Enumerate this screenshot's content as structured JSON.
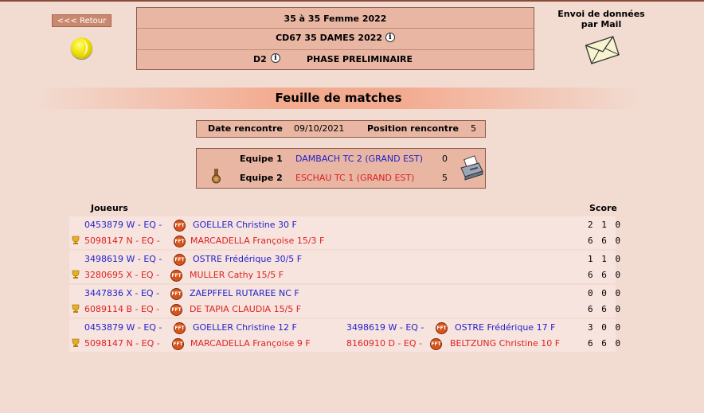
{
  "nav": {
    "back_label": "<<< Retour"
  },
  "header": {
    "title": "35  à 35  Femme  2022",
    "competition": "CD67 35 DAMES 2022",
    "division": "D2",
    "phase": "PHASE PRELIMINAIRE"
  },
  "mail": {
    "line1": "Envoi de données",
    "line2": "par Mail"
  },
  "sheet": {
    "title": "Feuille de matches"
  },
  "meeting": {
    "date_label": "Date rencontre",
    "date_value": "09/10/2021",
    "position_label": "Position rencontre",
    "position_value": "5"
  },
  "teams": [
    {
      "label": "Equipe 1",
      "name": "DAMBACH TC 2 (GRAND EST)",
      "score": "0"
    },
    {
      "label": "Equipe 2",
      "name": "ESCHAU TC 1 (GRAND EST)",
      "score": "5"
    }
  ],
  "table": {
    "players_header": "Joueurs",
    "score_header": "Score"
  },
  "matches": [
    {
      "line1": {
        "id": "0453879 W -   EQ -",
        "player": "GOELLER  Christine  30 F",
        "score": "2 1 0"
      },
      "line2": {
        "id": "5098147 N -   EQ -",
        "player": "MARCADELLA  Françoise 15/3 F",
        "score": "6 6 0"
      }
    },
    {
      "line1": {
        "id": "3498619 W -   EQ -",
        "player": "OSTRE  Frédérique  30/5 F",
        "score": "1 1 0"
      },
      "line2": {
        "id": "3280695 X -   EQ -",
        "player": "MULLER  Cathy 15/5 F",
        "score": "6 6 0"
      }
    },
    {
      "line1": {
        "id": "3447836 X -   EQ -",
        "player": "ZAEPFFEL  RUTAREE  NC F",
        "score": "0 0 0"
      },
      "line2": {
        "id": "6089114 B -   EQ -",
        "player": "DE TAPIA  CLAUDIA 15/5 F",
        "score": "6 6 0"
      }
    },
    {
      "line1": {
        "id": "0453879 W -   EQ -",
        "player": "GOELLER  Christine  12 F",
        "id2": "3498619 W -   EQ -",
        "player2": "OSTRE  Frédérique  17 F",
        "score": "3 0 0"
      },
      "line2": {
        "id": "5098147 N -   EQ -",
        "player": "MARCADELLA  Françoise 9 F",
        "id2": "8160910 D - EQ -",
        "player2": "BELTZUNG  Christine 10 F",
        "score": "6 6 0"
      }
    }
  ],
  "colors": {
    "background": "#f2dcd2",
    "box": "#e8b6a2",
    "team1": "#2222cc",
    "team2": "#dd2222",
    "banner": "#f3ab90"
  },
  "icons": {
    "ball": "tennis-ball-icon",
    "mail": "envelope-icon",
    "info": "info-icon",
    "printer": "printer-icon",
    "medal": "medal-icon",
    "trophy": "trophy-icon",
    "fft": "fft-logo-icon"
  }
}
